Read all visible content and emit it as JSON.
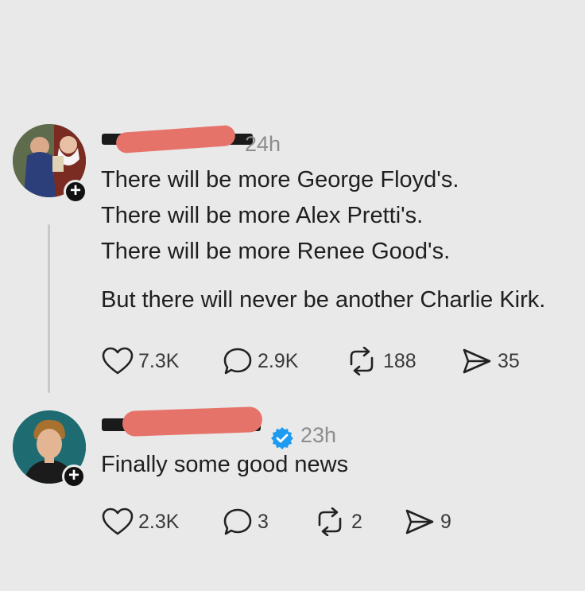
{
  "posts": [
    {
      "time": "24h",
      "lines": [
        "There will be more George Floyd's.",
        "There will be more Alex Pretti's.",
        "There will be more Renee Good's.",
        "But there will never be another Charlie Kirk."
      ],
      "actions": {
        "likes": "7.3K",
        "replies": "2.9K",
        "reposts": "188",
        "shares": "35"
      }
    },
    {
      "time": "23h",
      "verified": true,
      "text": "Finally some good news",
      "actions": {
        "likes": "2.3K",
        "replies": "3",
        "reposts": "2",
        "shares": "9"
      }
    }
  ],
  "colors": {
    "background": "#e9e9e9",
    "redaction_red": "#e6736a",
    "verified_blue": "#1d9bf0"
  }
}
